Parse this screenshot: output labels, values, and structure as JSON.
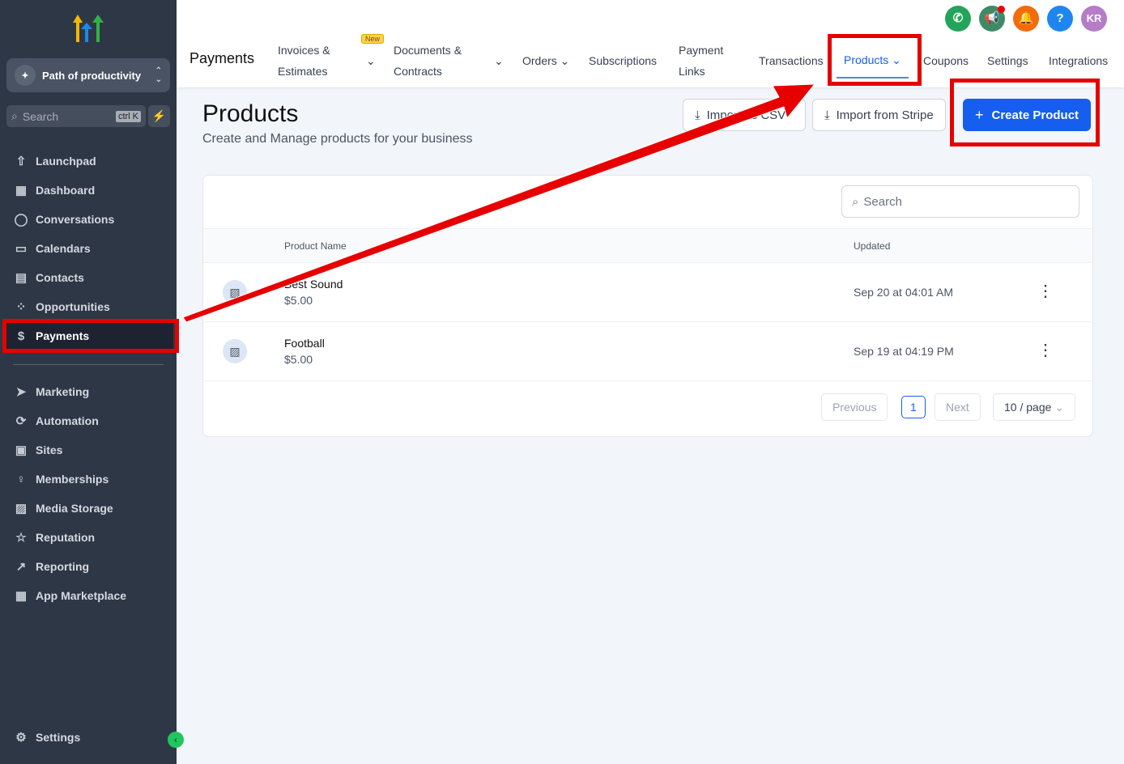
{
  "sidebar": {
    "location": "Path of productivity",
    "search_placeholder": "Search",
    "shortcut": "ctrl K",
    "items": [
      {
        "label": "Launchpad",
        "icon": "rocket-icon"
      },
      {
        "label": "Dashboard",
        "icon": "grid-icon"
      },
      {
        "label": "Conversations",
        "icon": "chat-icon"
      },
      {
        "label": "Calendars",
        "icon": "calendar-icon"
      },
      {
        "label": "Contacts",
        "icon": "contacts-icon"
      },
      {
        "label": "Opportunities",
        "icon": "opportunities-icon"
      },
      {
        "label": "Payments",
        "icon": "payments-icon",
        "active": true
      }
    ],
    "items2": [
      {
        "label": "Marketing"
      },
      {
        "label": "Automation"
      },
      {
        "label": "Sites"
      },
      {
        "label": "Memberships"
      },
      {
        "label": "Media Storage"
      },
      {
        "label": "Reputation"
      },
      {
        "label": "Reporting"
      },
      {
        "label": "App Marketplace"
      }
    ],
    "settings": "Settings"
  },
  "header": {
    "title": "Payments",
    "new_badge": "New",
    "tabs": [
      "Invoices &",
      "Estimates",
      "Documents &",
      "Contracts",
      "Orders",
      "Subscriptions",
      "Payment",
      "Links",
      "Transactions",
      "Products",
      "Coupons",
      "Settings",
      "Integrations"
    ],
    "avatar": "KR",
    "accent": "#155eef"
  },
  "page": {
    "title": "Products",
    "subtitle": "Create and Manage products for your business",
    "import_csv": "Import as CSV",
    "import_stripe": "Import from Stripe",
    "create": "Create Product"
  },
  "table": {
    "search_placeholder": "Search",
    "columns": [
      "Product Name",
      "Updated"
    ],
    "rows": [
      {
        "name": "Best Sound",
        "price": "$5.00",
        "updated": "Sep 20 at 04:01 AM"
      },
      {
        "name": "Football",
        "price": "$5.00",
        "updated": "Sep 19 at 04:19 PM"
      }
    ],
    "pagination": {
      "previous": "Previous",
      "page": "1",
      "next": "Next",
      "per_page": "10 / page"
    }
  }
}
